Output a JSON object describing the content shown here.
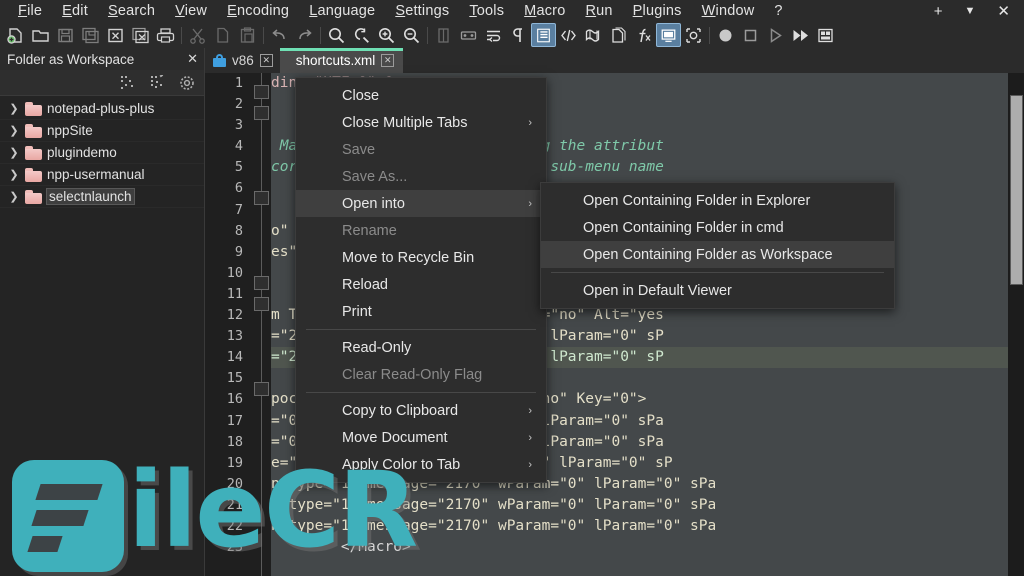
{
  "menubar": {
    "items": [
      "File",
      "Edit",
      "Search",
      "View",
      "Encoding",
      "Language",
      "Settings",
      "Tools",
      "Macro",
      "Run",
      "Plugins",
      "Window",
      "?"
    ],
    "window_controls": [
      {
        "name": "add-tab-button",
        "glyph": "+"
      },
      {
        "name": "tab-list-button",
        "glyph": "▼"
      },
      {
        "name": "close-window-button",
        "glyph": "✕"
      }
    ]
  },
  "toolbar": {
    "icons": [
      "new-file-icon",
      "open-file-icon",
      "save-icon",
      "save-all-icon",
      "close-file-icon",
      "close-all-files-icon",
      "print-icon",
      "cut-icon",
      "copy-icon",
      "paste-icon",
      "undo-icon",
      "redo-icon",
      "find-icon",
      "replace-icon",
      "zoom-in-icon",
      "zoom-out-icon",
      "sync-vertical-scroll-icon",
      "sync-horizontal-scroll-icon",
      "word-wrap-icon",
      "show-all-characters-icon",
      "indent-guide-icon",
      "html-tag-icon",
      "user-defined-language-icon",
      "document-map-icon",
      "function-list-icon",
      "folder-as-workspace-icon",
      "monitoring-icon",
      "record-macro-icon",
      "stop-recording-icon",
      "play-macro-icon",
      "run-macro-multiple-icon",
      "save-macro-icon"
    ],
    "selected": [
      "indent-guide-icon",
      "folder-as-workspace-icon"
    ]
  },
  "workspace": {
    "title": "Folder as Workspace",
    "close_glyph": "✕",
    "tools": [
      "collapse-all-icon",
      "expand-all-icon",
      "workspace-settings-icon"
    ],
    "arrow_glyph": "❯",
    "items": [
      {
        "label": "notepad-plus-plus",
        "selected": false
      },
      {
        "label": "nppSite",
        "selected": false
      },
      {
        "label": "plugindemo",
        "selected": false
      },
      {
        "label": "npp-usermanual",
        "selected": false
      },
      {
        "label": "selectnlaunch",
        "selected": true
      }
    ]
  },
  "tabs": [
    {
      "label": "v86",
      "active": false,
      "close_glyph": "✕",
      "icon": "locked-document-icon"
    },
    {
      "label": "shortcuts.xml",
      "active": true,
      "close_glyph": "✕"
    }
  ],
  "editor": {
    "line_numbers": [
      "1",
      "2",
      "3",
      "4",
      "5",
      "6",
      "7",
      "8",
      "9",
      "10",
      "11",
      "12",
      "13",
      "14",
      "15",
      "16",
      "17",
      "18",
      "19",
      "20",
      "21",
      "22",
      "23"
    ],
    "lines": [
      {
        "text": "ding=\"UTF-8\" ?>",
        "kind": "decl"
      },
      {
        "text": "",
        "kind": "plain"
      },
      {
        "text": "",
        "kind": "plain"
      },
      {
        "text": " Macro menu & Run menu by adding the attribut",
        "kind": "comment"
      },
      {
        "text": "corresponding node within a \"My sub-menu name",
        "kind": "comment"
      },
      {
        "text": "",
        "kind": "plain"
      },
      {
        "text": "",
        "kind": "plain"
      },
      {
        "text": "o\"  Key=\"67\"",
        "kind": "attr"
      },
      {
        "text": "es\"  Key=\"67",
        "kind": "attr"
      },
      {
        "text": "",
        "kind": "plain"
      },
      {
        "text": "",
        "kind": "plain"
      },
      {
        "text": "m Trailing Space and Save\" Ctrl=\"no\" Alt=\"yes",
        "kind": "attr"
      },
      {
        "text": "=\"2\" message=\"0\" wParam=\"42024\" lParam=\"0\" sP",
        "kind": "attr"
      },
      {
        "text": "=\"2\" message=\"0\" wParam=\"41006\" lParam=\"0\" sP",
        "kind": "attr-hl"
      },
      {
        "text": "",
        "kind": "plain"
      },
      {
        "text": "poc\" Ctrl=\"no\" Alt=\"no\" Shift=\"no\" Key=\"0\">",
        "kind": "attr"
      },
      {
        "text": "=\"0\" message=\"2422\" wParam=\"0\" lParam=\"0\" sPa",
        "kind": "attr"
      },
      {
        "text": "=\"0\" message=\"2325\" wParam=\"0\" lParam=\"0\" sPa",
        "kind": "attr"
      },
      {
        "text": "e=\"2\" message=\"0\" wParam=\"41001\" lParam=\"0\" sP",
        "kind": "attr"
      },
      {
        "text": "n type=\"1\" message=\"2170\" wParam=\"0\" lParam=\"0\" sPa",
        "kind": "attr"
      },
      {
        "text": "n type=\"1\" message=\"2170\" wParam=\"0\" lParam=\"0\" sPa",
        "kind": "attr"
      },
      {
        "text": "n type=\"1\" message=\"2170\" wParam=\"0\" lParam=\"0\" sPa",
        "kind": "attr"
      },
      {
        "text": "        </Macro>",
        "kind": "tag"
      }
    ]
  },
  "context_menu": {
    "arrow_glyph": "›",
    "items": [
      {
        "label": "Close",
        "disabled": false,
        "submenu": false,
        "hover": false
      },
      {
        "label": "Close Multiple Tabs",
        "disabled": false,
        "submenu": true,
        "hover": false
      },
      {
        "label": "Save",
        "disabled": true,
        "submenu": false,
        "hover": false
      },
      {
        "label": "Save As...",
        "disabled": true,
        "submenu": false,
        "hover": false
      },
      {
        "label": "Open into",
        "disabled": false,
        "submenu": true,
        "hover": true
      },
      {
        "label": "Rename",
        "disabled": true,
        "submenu": false,
        "hover": false
      },
      {
        "label": "Move to Recycle Bin",
        "disabled": false,
        "submenu": false,
        "hover": false
      },
      {
        "label": "Reload",
        "disabled": false,
        "submenu": false,
        "hover": false
      },
      {
        "label": "Print",
        "disabled": false,
        "submenu": false,
        "hover": false
      },
      {
        "label": "__SEP__",
        "disabled": false,
        "submenu": false,
        "hover": false
      },
      {
        "label": "Read-Only",
        "disabled": false,
        "submenu": false,
        "hover": false
      },
      {
        "label": "Clear Read-Only Flag",
        "disabled": true,
        "submenu": false,
        "hover": false
      },
      {
        "label": "__SEP__",
        "disabled": false,
        "submenu": false,
        "hover": false
      },
      {
        "label": "Copy to Clipboard",
        "disabled": false,
        "submenu": true,
        "hover": false
      },
      {
        "label": "Move Document",
        "disabled": false,
        "submenu": true,
        "hover": false
      },
      {
        "label": "Apply Color to Tab",
        "disabled": false,
        "submenu": true,
        "hover": false
      }
    ]
  },
  "submenu": {
    "items": [
      {
        "label": "Open Containing Folder in Explorer",
        "hover": false
      },
      {
        "label": "Open Containing Folder in cmd",
        "hover": false
      },
      {
        "label": "Open Containing Folder as Workspace",
        "hover": true
      },
      {
        "label": "__SEP__",
        "hover": false
      },
      {
        "label": "Open in Default Viewer",
        "hover": false
      }
    ]
  },
  "watermark": {
    "text": "ileCR"
  },
  "colors": {
    "accent_tab": "#6fe0b4",
    "watermark": "#3fb0bb",
    "editor_bg": "#44484a",
    "menu_bg": "#2d2d2d",
    "panel_bg": "#242424",
    "folder": "#efb6b2"
  }
}
